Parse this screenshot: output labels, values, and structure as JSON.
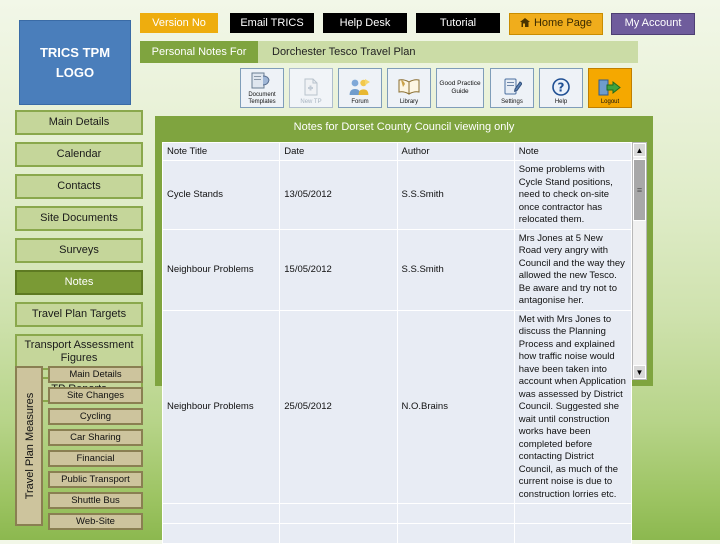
{
  "logo": {
    "line1": "TRICS TPM",
    "line2": "LOGO"
  },
  "topnav": [
    {
      "label": "Version No",
      "style": "gold"
    },
    {
      "label": "Email TRICS",
      "style": "black"
    },
    {
      "label": "Help Desk",
      "style": "black"
    },
    {
      "label": "Tutorial",
      "style": "black"
    },
    {
      "label": "Home Page",
      "style": "gold2",
      "icon": "house-icon"
    },
    {
      "label": "My Account",
      "style": "purple"
    }
  ],
  "context_bar": {
    "tag": "Personal Notes For",
    "value": "Dorchester Tesco Travel Plan"
  },
  "toolbar": [
    {
      "label": "Document Templates",
      "icon": "document-templates-icon",
      "disabled": false
    },
    {
      "label": "New TP",
      "icon": "new-tp-icon",
      "disabled": true
    },
    {
      "label": "Forum",
      "icon": "forum-icon",
      "disabled": false
    },
    {
      "label": "Library",
      "icon": "library-icon",
      "disabled": false
    },
    {
      "label": "Good Practice Guide",
      "icon": "good-practice-guide-icon",
      "disabled": false
    },
    {
      "label": "Settings",
      "icon": "settings-icon",
      "disabled": false
    },
    {
      "label": "Help",
      "icon": "help-icon",
      "disabled": false
    },
    {
      "label": "Logout",
      "icon": "logout-icon",
      "disabled": false
    }
  ],
  "sidebar": [
    {
      "label": "Main Details",
      "selected": false
    },
    {
      "label": "Calendar",
      "selected": false
    },
    {
      "label": "Contacts",
      "selected": false
    },
    {
      "label": "Site Documents",
      "selected": false
    },
    {
      "label": "Surveys",
      "selected": false
    },
    {
      "label": "Notes",
      "selected": true
    },
    {
      "label": "Travel Plan Targets",
      "selected": false
    },
    {
      "label": "Transport Assessment Figures",
      "selected": false
    },
    {
      "label": "TP Reports",
      "selected": false
    }
  ],
  "measures": {
    "title": "Travel Plan Measures",
    "items": [
      {
        "label": "Main Details"
      },
      {
        "label": "Site Changes"
      },
      {
        "label": "Cycling"
      },
      {
        "label": "Car Sharing"
      },
      {
        "label": "Financial"
      },
      {
        "label": "Public Transport"
      },
      {
        "label": "Shuttle Bus"
      },
      {
        "label": "Web-Site"
      }
    ]
  },
  "panel": {
    "title": "Notes for Dorset County Council viewing only",
    "columns": [
      "Note Title",
      "Date",
      "Author",
      "Note"
    ],
    "rows": [
      {
        "title": "Cycle Stands",
        "date": "13/05/2012",
        "author": "S.S.Smith",
        "note": "Some problems with Cycle Stand positions, need to check on-site once contractor has relocated them."
      },
      {
        "title": "Neighbour Problems",
        "date": "15/05/2012",
        "author": "S.S.Smith",
        "note": "Mrs Jones at 5 New Road very angry with Council and the way they allowed the new Tesco.  Be aware and try not to antagonise her."
      },
      {
        "title": "Neighbour Problems",
        "date": "25/05/2012",
        "author": "N.O.Brains",
        "note": "Met with Mrs Jones to discuss the Planning Process and explained how traffic noise would have been taken into account when Application was assessed by District Council.  Suggested she wait until construction works have been completed before contacting District Council, as much of the current noise is due to construction lorries etc."
      },
      {
        "title": "",
        "date": "",
        "author": "",
        "note": ""
      },
      {
        "title": "",
        "date": "",
        "author": "",
        "note": ""
      }
    ],
    "scrollbar": {
      "up": "▲",
      "down": "▼",
      "thumb_grip": "≡"
    }
  },
  "colors": {
    "accent_green": "#7fa43f",
    "sidebar_green": "#c5d69a",
    "selected_green": "#7a9a35",
    "measure_tan": "#cdc49d",
    "gold": "#eead0e",
    "purple": "#6f5c9c",
    "logo_blue": "#4a7ebb"
  }
}
